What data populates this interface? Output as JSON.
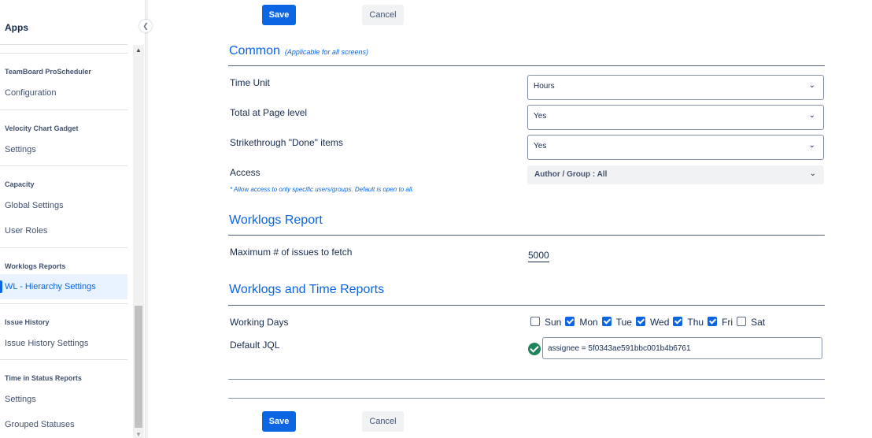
{
  "sidebar": {
    "title": "Apps",
    "sections": [
      {
        "heading": "TeamBoard ProScheduler",
        "items": [
          "Configuration"
        ]
      },
      {
        "heading": "Velocity Chart Gadget",
        "items": [
          "Settings"
        ]
      },
      {
        "heading": "Capacity",
        "items": [
          "Global Settings",
          "User Roles"
        ]
      },
      {
        "heading": "Worklogs Reports",
        "items": [
          "WL - Hierarchy Settings"
        ],
        "active_item": "WL - Hierarchy Settings"
      },
      {
        "heading": "Issue History",
        "items": [
          "Issue History Settings"
        ]
      },
      {
        "heading": "Time in Status Reports",
        "items": [
          "Settings",
          "Grouped Statuses"
        ]
      }
    ]
  },
  "actions": {
    "save_label": "Save",
    "cancel_label": "Cancel"
  },
  "common": {
    "title": "Common",
    "note": "(Applicable for all screens)",
    "fields": [
      {
        "label": "Time Unit",
        "value": "Hours"
      },
      {
        "label": "Total at Page level",
        "value": "Yes"
      },
      {
        "label": "Strikethrough \"Done\" items",
        "value": "Yes"
      }
    ],
    "access": {
      "label": "Access",
      "value": "Author / Group : All",
      "hint": "* Allow access to only specific users/groups. Default is open to all."
    }
  },
  "worklogs_report": {
    "title": "Worklogs Report",
    "max_issues_label": "Maximum # of issues to fetch",
    "max_issues_value": "5000"
  },
  "worklogs_time": {
    "title": "Worklogs and Time Reports",
    "working_days_label": "Working Days",
    "days": [
      {
        "label": "Sun",
        "checked": false
      },
      {
        "label": "Mon",
        "checked": true
      },
      {
        "label": "Tue",
        "checked": true
      },
      {
        "label": "Wed",
        "checked": true
      },
      {
        "label": "Thu",
        "checked": true
      },
      {
        "label": "Fri",
        "checked": true
      },
      {
        "label": "Sat",
        "checked": false
      }
    ],
    "jql_label": "Default JQL",
    "jql_value": "assignee = 5f0343ae591bbc001b4b6761",
    "jql_status": "valid"
  },
  "colors": {
    "accent": "#0c66e4",
    "valid": "#1f845a",
    "active_bg": "#e9f2ff"
  },
  "icons": {
    "collapse": "chevron-left-icon",
    "select": "chevron-down-icon",
    "jql_status": "check-circle-icon"
  }
}
